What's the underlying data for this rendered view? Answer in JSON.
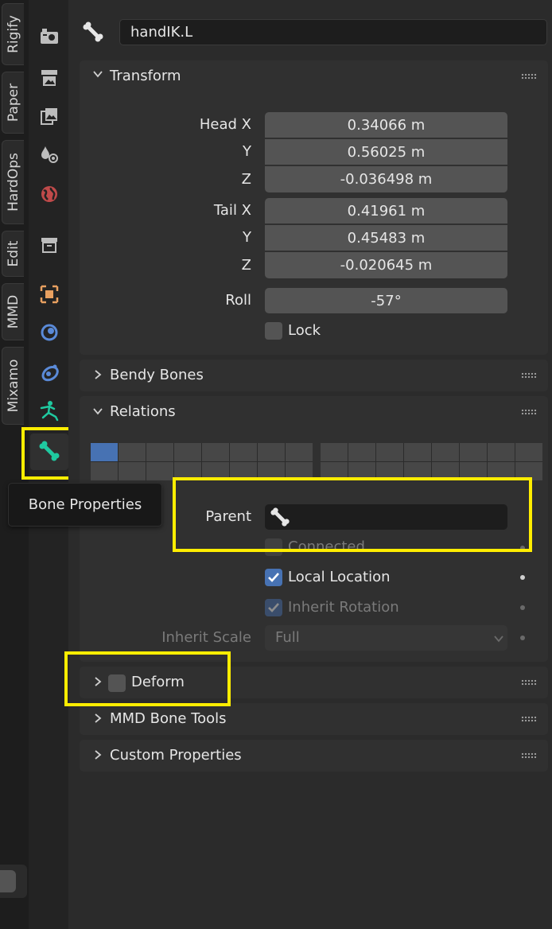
{
  "side_tabs": [
    "Rigify",
    "Paper",
    "HardOps",
    "Edit",
    "MMD",
    "Mixamo"
  ],
  "icons": [
    "render-icon",
    "output-icon",
    "view-layer-icon",
    "scene-icon",
    "world-icon",
    "collection-icon",
    "object-icon",
    "modifiers-icon",
    "physics-icon",
    "object-data-armature-icon",
    "bone-icon"
  ],
  "tooltip": "Bone Properties",
  "header": {
    "bone_name": "handIK.L"
  },
  "transform": {
    "title": "Transform",
    "head_label": "Head X",
    "tail_label": "Tail X",
    "y_label": "Y",
    "z_label": "Z",
    "head": [
      "0.34066 m",
      "0.56025 m",
      "-0.036498 m"
    ],
    "tail": [
      "0.41961 m",
      "0.45483 m",
      "-0.020645 m"
    ],
    "roll_label": "Roll",
    "roll": "-57°",
    "lock_label": "Lock",
    "lock": false
  },
  "bendy_bones": {
    "title": "Bendy Bones"
  },
  "relations": {
    "title": "Relations",
    "parent_label": "Parent",
    "parent_value": "",
    "connected_label": "Connected",
    "connected": false,
    "local_location_label": "Local Location",
    "local_location": true,
    "inherit_rotation_label": "Inherit Rotation",
    "inherit_rotation": true,
    "inherit_scale_label": "Inherit Scale",
    "inherit_scale_value": "Full"
  },
  "deform": {
    "title": "Deform",
    "enabled": false
  },
  "mmd_bone_tools": {
    "title": "MMD Bone Tools"
  },
  "custom_properties": {
    "title": "Custom Properties"
  },
  "colors": {
    "accent": "#4772b3",
    "highlight": "#ffed00",
    "active_icon": "#1fc9a0"
  }
}
